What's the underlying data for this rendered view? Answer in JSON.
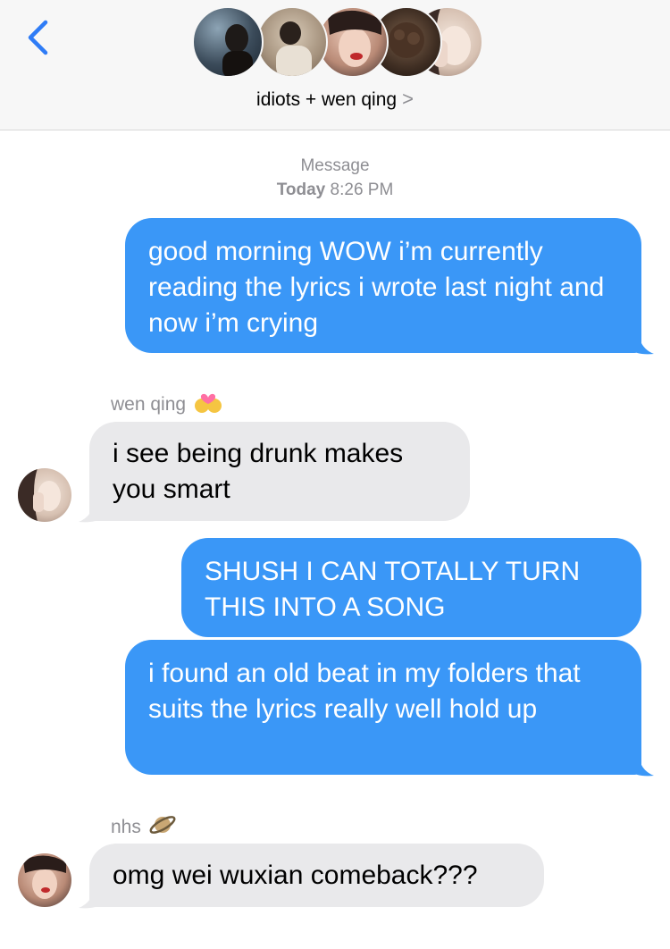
{
  "header": {
    "group_name": "idiots + wen qing",
    "chevron": ">",
    "back_icon": "chevron-left-icon"
  },
  "timestamp": {
    "label": "Message",
    "day": "Today",
    "time": "8:26 PM"
  },
  "messages": [
    {
      "sender": "",
      "text": "good morning WOW i’m currently reading the lyrics i wrote last night and now i’m crying"
    },
    {
      "sender": "wen qing",
      "text": "i see being drunk makes you smart"
    },
    {
      "sender": "",
      "text": "SHUSH I CAN TOTALLY TURN THIS INTO A SONG"
    },
    {
      "sender": "",
      "text": "i found an old beat in my folders that suits the lyrics really well hold up"
    },
    {
      "sender": "nhs",
      "text": "omg wei wuxian comeback???"
    }
  ],
  "colors": {
    "outgoing": "#3a97f7",
    "incoming": "#e9e9eb",
    "accent": "#2f7cf6",
    "meta": "#8e8e93"
  }
}
